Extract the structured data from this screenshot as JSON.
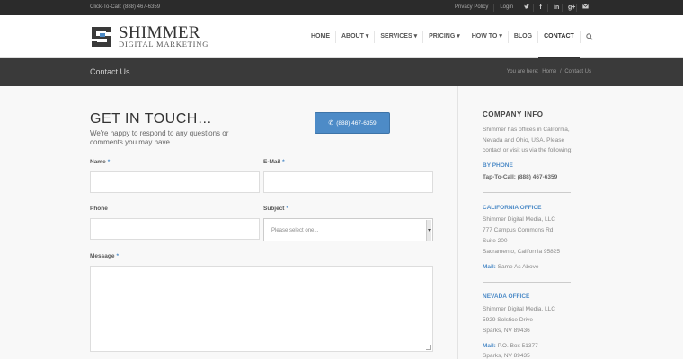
{
  "topbar": {
    "click_to_call": "Click-To-Call: (888) 467-6359",
    "links": [
      "Privacy Policy",
      "Login"
    ],
    "social": [
      "twitter-icon",
      "facebook-icon",
      "linkedin-icon",
      "googleplus-icon",
      "mail-icon"
    ]
  },
  "logo": {
    "name": "SHIMMER",
    "tagline": "DIGITAL MARKETING"
  },
  "nav": {
    "items": [
      "HOME",
      "ABOUT ▾",
      "SERVICES ▾",
      "PRICING ▾",
      "HOW TO ▾",
      "BLOG",
      "CONTACT"
    ],
    "active": "CONTACT"
  },
  "titlebar": {
    "title": "Contact Us",
    "breadcrumb_prefix": "You are here:",
    "breadcrumb_home": "Home",
    "breadcrumb_sep": "/",
    "breadcrumb_current": "Contact Us"
  },
  "form": {
    "heading": "GET IN TOUCH…",
    "intro": "We're happy to respond to any questions or comments you may have.",
    "call_button": "(888) 467-6359",
    "name_label": "Name",
    "email_label": "E-Mail",
    "phone_label": "Phone",
    "subject_label": "Subject",
    "subject_placeholder": "Please select one...",
    "message_label": "Message",
    "required_mark": "*"
  },
  "sidebar": {
    "heading": "COMPANY INFO",
    "intro": "Shimmer has offices in California, Nevada and Ohio, USA. Please contact or visit us via the following:",
    "by_phone": {
      "title": "BY PHONE",
      "line": "Tap-To-Call: (888) 467-6359"
    },
    "california": {
      "title": "CALIFORNIA OFFICE",
      "lines": [
        "Shimmer Digital Media, LLC",
        "777 Campus Commons Rd.",
        "Suite 200",
        "Sacramento, California 95825"
      ],
      "mail_label": "Mail:",
      "mail_value": "Same As Above"
    },
    "nevada": {
      "title": "NEVADA OFFICE",
      "lines": [
        "Shimmer Digital Media, LLC",
        "5929 Solstice Drive",
        "Sparks, NV 89436"
      ],
      "mail_label": "Mail:",
      "mail_value": "P.O. Box 51377",
      "mail_city": "Sparks, NV 89435"
    }
  },
  "colors": {
    "accent": "#4d8bc7",
    "topbar": "#2b2b2b",
    "titlebar": "#3a3a3a"
  }
}
